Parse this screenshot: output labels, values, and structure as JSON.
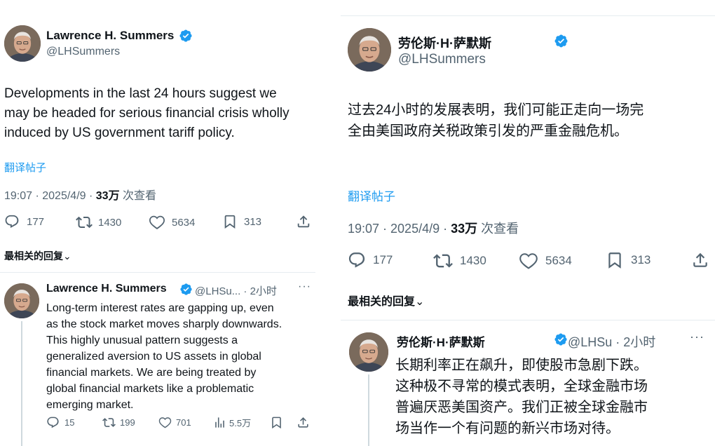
{
  "left": {
    "tweet": {
      "name": "Lawrence H. Summers",
      "handle": "@LHSummers",
      "text_lines": [
        "Developments in the last 24 hours suggest we",
        "may be headed for serious financial crisis wholly",
        "induced by US government tariff policy."
      ],
      "translate": "翻译帖子",
      "time": "19:07 · 2025/4/9 · ",
      "views": "33万",
      "views_suffix": " 次查看",
      "replies": "177",
      "retweets": "1430",
      "likes": "5634",
      "bookmarks": "313"
    },
    "replies_header": "最相关的回复",
    "reply": {
      "name": "Lawrence H. Summers",
      "handle": "@LHSu... · 2小时",
      "more": "···",
      "text_lines": [
        "Long-term interest rates are gapping up, even",
        "as the stock market moves sharply downwards.",
        "This highly unusual pattern suggests a",
        "generalized aversion to US assets in global",
        "financial markets.  We are being treated by",
        "global financial markets like a problematic",
        "emerging market."
      ],
      "replies": "15",
      "retweets": "199",
      "likes": "701",
      "views": "5.5万"
    }
  },
  "right": {
    "tweet": {
      "name": "劳伦斯·H·萨默斯",
      "handle": "@LHSummers",
      "text_lines": [
        "过去24小时的发展表明，我们可能正走向一场完",
        "全由美国政府关税政策引发的严重金融危机。"
      ],
      "translate": "翻译帖子",
      "time": "19:07 · 2025/4/9 · ",
      "views": "33万",
      "views_suffix": " 次查看",
      "replies": "177",
      "retweets": "1430",
      "likes": "5634",
      "bookmarks": "313"
    },
    "replies_header": "最相关的回复",
    "reply": {
      "name": "劳伦斯·H·萨默斯",
      "handle": "@LHSu · 2小时",
      "more": "···",
      "text_lines": [
        "长期利率正在飙升，即使股市急剧下跌。",
        "这种极不寻常的模式表明，全球金融市场",
        "普遍厌恶美国资产。我们正被全球金融市",
        "场当作一个有问题的新兴市场对待。"
      ]
    }
  },
  "colors": {
    "verified": "#1d9bf0",
    "link": "#1d9bf0",
    "secondary_text": "#536471",
    "primary_text": "#0f1419"
  }
}
